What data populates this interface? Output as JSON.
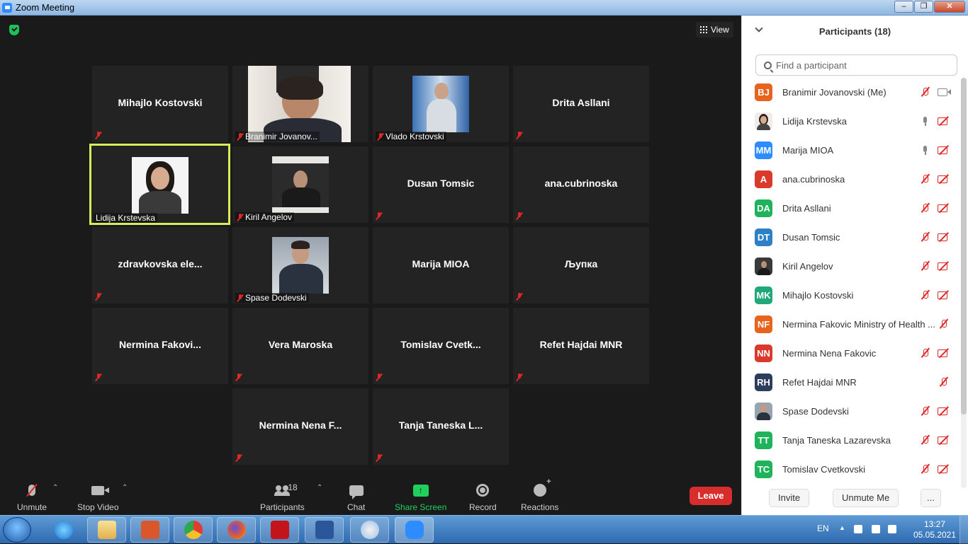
{
  "window": {
    "title": "Zoom Meeting"
  },
  "view_button": {
    "label": "View"
  },
  "tiles": [
    {
      "name": "Mihajlo Kostovski",
      "label": ""
    },
    {
      "name": "",
      "label": "Branimir Jovanov..."
    },
    {
      "name": "",
      "label": "Vlado Krstovski"
    },
    {
      "name": "Drita Asllani",
      "label": ""
    },
    {
      "name": "",
      "label": "Lidija Krstevska"
    },
    {
      "name": "",
      "label": "Kiril Angelov"
    },
    {
      "name": "Dusan Tomsic",
      "label": ""
    },
    {
      "name": "ana.cubrinoska",
      "label": ""
    },
    {
      "name": "zdravkovska  ele...",
      "label": ""
    },
    {
      "name": "",
      "label": "Spase Dodevski"
    },
    {
      "name": "Marija MIOA",
      "label": ""
    },
    {
      "name": "Љупка",
      "label": ""
    },
    {
      "name": "Nermina  Fakovi...",
      "label": ""
    },
    {
      "name": "Vera Maroska",
      "label": ""
    },
    {
      "name": "Tomislav  Cvetk...",
      "label": ""
    },
    {
      "name": "Refet Hajdai MNR",
      "label": ""
    },
    {
      "name": "Nermina Nena F...",
      "label": ""
    },
    {
      "name": "Tanja Taneska L...",
      "label": ""
    }
  ],
  "toolbar": {
    "unmute": "Unmute",
    "stop_video": "Stop Video",
    "participants": "Participants",
    "participants_count": "18",
    "chat": "Chat",
    "share_screen": "Share Screen",
    "record": "Record",
    "reactions": "Reactions",
    "leave": "Leave"
  },
  "panel": {
    "title": "Participants (18)",
    "search_placeholder": "Find a participant",
    "participants": [
      {
        "initials": "BJ",
        "name": "Branimir Jovanovski (Me)",
        "color": "#e8641e"
      },
      {
        "initials": "",
        "name": "Lidija Krstevska",
        "color": "#8a6a5a"
      },
      {
        "initials": "MM",
        "name": "Marija MIOA",
        "color": "#2d8cff"
      },
      {
        "initials": "A",
        "name": "ana.cubrinoska",
        "color": "#d93a2b"
      },
      {
        "initials": "DA",
        "name": "Drita Asllani",
        "color": "#1fb35c"
      },
      {
        "initials": "DT",
        "name": "Dusan Tomsic",
        "color": "#2d7fc6"
      },
      {
        "initials": "",
        "name": "Kiril Angelov",
        "color": "#444444"
      },
      {
        "initials": "MK",
        "name": "Mihajlo Kostovski",
        "color": "#20a87a"
      },
      {
        "initials": "NF",
        "name": "Nermina Fakovic Ministry of Health ...",
        "color": "#e8641e"
      },
      {
        "initials": "NN",
        "name": "Nermina Nena Fakovic",
        "color": "#d93a2b"
      },
      {
        "initials": "RH",
        "name": "Refet Hajdai MNR",
        "color": "#2c3e5c"
      },
      {
        "initials": "",
        "name": "Spase Dodevski",
        "color": "#5a6070"
      },
      {
        "initials": "TT",
        "name": "Tanja Taneska Lazarevska",
        "color": "#1fb35c"
      },
      {
        "initials": "TC",
        "name": "Tomislav Cvetkovski",
        "color": "#1fb35c"
      }
    ],
    "invite": "Invite",
    "unmute_me": "Unmute Me",
    "more": "..."
  },
  "taskbar": {
    "language": "EN",
    "time": "13:27",
    "date": "05.05.2021"
  }
}
